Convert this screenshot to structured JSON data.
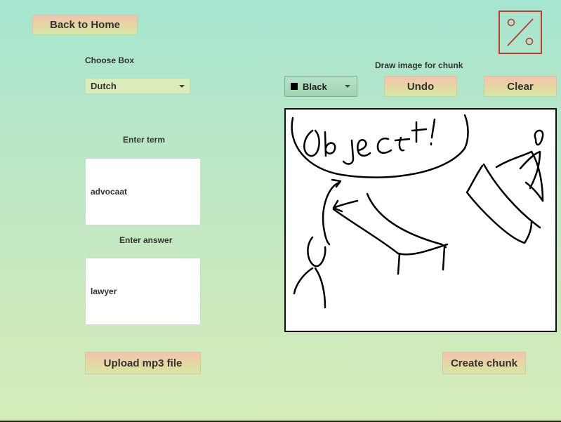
{
  "nav": {
    "back_label": "Back to Home"
  },
  "box": {
    "label": "Choose Box",
    "selected": "Dutch"
  },
  "term": {
    "label": "Enter term",
    "value": "advocaat"
  },
  "answer": {
    "label": "Enter answer",
    "value": "lawyer"
  },
  "upload_label": "Upload mp3 file",
  "drawing": {
    "label": "Draw image for chunk",
    "color_selected": "Black",
    "undo_label": "Undo",
    "clear_label": "Clear",
    "stroke_color": "#000000"
  },
  "create_label": "Create chunk",
  "logo_icon": "percent-icon",
  "colors": {
    "logo": "#c0392b",
    "button_top": "#f3c2b0",
    "button_bottom": "#d5e8a6"
  }
}
